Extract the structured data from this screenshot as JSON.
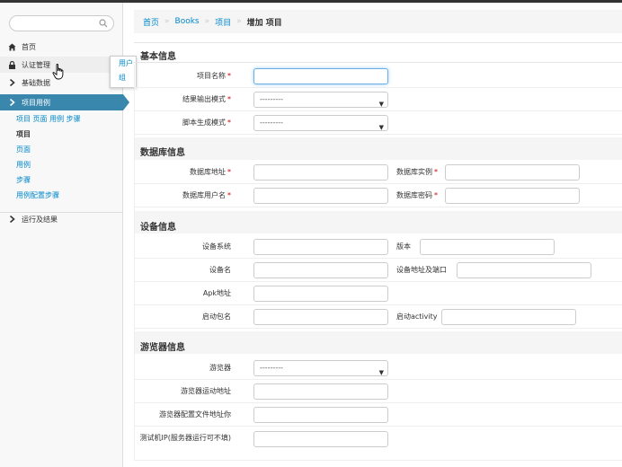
{
  "sidebar": {
    "search_placeholder": "",
    "items": [
      {
        "label": "首页",
        "icon": "home-icon"
      },
      {
        "label": "认证管理",
        "icon": "lock-icon"
      },
      {
        "label": "基础数据",
        "icon": "chevron-right-icon"
      },
      {
        "label": "项目用例",
        "icon": "chevron-right-icon"
      },
      {
        "label": "运行及结果",
        "icon": "chevron-right-icon"
      }
    ],
    "submenu": [
      {
        "label": "项目 页面 用例 步骤"
      },
      {
        "label": "项目"
      },
      {
        "label": "页面"
      },
      {
        "label": "用例"
      },
      {
        "label": "步骤"
      },
      {
        "label": "用例配置步骤"
      }
    ],
    "popover": [
      "用户",
      "组"
    ]
  },
  "breadcrumb": {
    "home": "首页",
    "app": "Books",
    "model": "项目",
    "current": "增加 项目"
  },
  "sections": {
    "basic": {
      "title": "基本信息",
      "name_label": "项目名称",
      "output_label": "结果输出模式",
      "output_value": "---------",
      "script_label": "脚本生成模式",
      "script_value": "---------"
    },
    "db": {
      "title": "数据库信息",
      "addr_label": "数据库地址",
      "inst_label": "数据库实例",
      "user_label": "数据库用户名",
      "pwd_label": "数据库密码"
    },
    "device": {
      "title": "设备信息",
      "os_label": "设备系统",
      "ver_label": "版本",
      "name_label": "设备名",
      "addr_label": "设备地址及端口",
      "apk_label": "Apk地址",
      "pkg_label": "启动包名",
      "activity_label": "启动activity"
    },
    "browser": {
      "title": "游览器信息",
      "browser_label": "游览器",
      "browser_value": "---------",
      "driver_label": "游览器运动地址",
      "config_label": "游览器配置文件地址你",
      "ip_label": "测试机IP(服务器运行可不填)"
    }
  },
  "required_mark": "*",
  "colors": {
    "accent": "#3a87ad",
    "link": "#0088cc"
  }
}
